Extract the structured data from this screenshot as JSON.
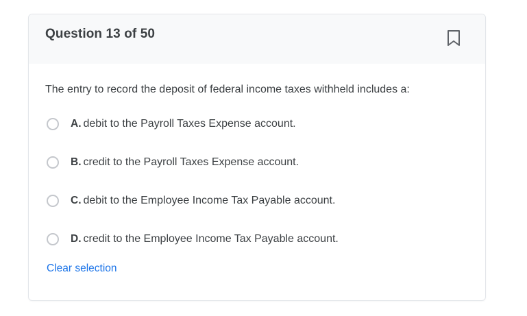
{
  "header": {
    "title": "Question 13 of 50",
    "bookmark_icon": "bookmark-icon"
  },
  "question": {
    "text": "The entry to record the deposit of federal income taxes withheld includes a:"
  },
  "options": [
    {
      "letter": "A.",
      "text": "debit to the Payroll Taxes Expense account.",
      "selected": false
    },
    {
      "letter": "B.",
      "text": "credit to the Payroll Taxes Expense account.",
      "selected": false
    },
    {
      "letter": "C.",
      "text": "debit to the Employee Income Tax Payable account.",
      "selected": false
    },
    {
      "letter": "D.",
      "text": "credit to the Employee Income Tax Payable account.",
      "selected": false
    }
  ],
  "actions": {
    "clear_label": "Clear selection"
  },
  "colors": {
    "accent": "#1a73e8",
    "header_bg": "#f8f9fa",
    "text": "#3c4043",
    "icon": "#5f6368"
  }
}
